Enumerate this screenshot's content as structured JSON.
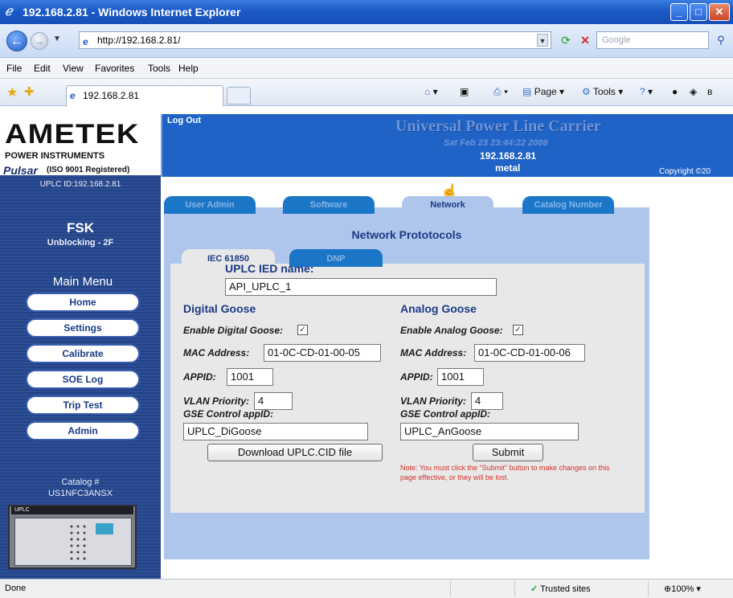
{
  "window": {
    "title": "192.168.2.81 - Windows Internet Explorer",
    "minimize": "_",
    "maximize": "□",
    "close": "✕"
  },
  "address": {
    "url": "http://192.168.2.81/",
    "search_placeholder": "Google"
  },
  "menu": [
    "File",
    "Edit",
    "View",
    "Favorites",
    "Tools",
    "Help"
  ],
  "tabs": {
    "active_label": "192.168.2.81"
  },
  "commands": {
    "home": "▾",
    "page": "Page ▾",
    "tools": "Tools ▾",
    "help": "▾"
  },
  "branding": {
    "company": "AMETEK",
    "division": "POWER INSTRUMENTS",
    "product_line": "Pulsar",
    "iso": "(ISO 9001 Registered)"
  },
  "header": {
    "logout": "Log Out",
    "product_title": "Universal Power Line Carrier",
    "date": "Sat Feb 23 23:44:22 2008",
    "ip": "192.168.2.81",
    "user": "metal",
    "copyright": "Copyright ©20"
  },
  "sidebar": {
    "upl_id": "UPLC ID:192.168.2.81",
    "mode": "FSK",
    "scheme": "Unblocking - 2F",
    "menu_title": "Main Menu",
    "items": [
      {
        "label": "Home"
      },
      {
        "label": "Settings"
      },
      {
        "label": "Calibrate"
      },
      {
        "label": "SOE Log"
      },
      {
        "label": "Trip Test"
      },
      {
        "label": "Admin"
      }
    ],
    "catalog_label": "Catalog #",
    "catalog_number": "US1NFC3ANSX",
    "device_label": "UPLC"
  },
  "main_tabs": [
    {
      "label": "User Admin"
    },
    {
      "label": "Software"
    },
    {
      "label": "Network"
    },
    {
      "label": "Catalog Number"
    }
  ],
  "network": {
    "title": "Network Prototocols",
    "sub_tabs": [
      {
        "label": "IEC 61850"
      },
      {
        "label": "DNP"
      }
    ],
    "ied_label": "UPLC IED name:",
    "ied_value": "API_UPLC_1",
    "digital": {
      "heading": "Digital Goose",
      "enable_label": "Enable Digital Goose:",
      "enabled": "✓",
      "mac_label": "MAC Address:",
      "mac_value": "01-0C-CD-01-00-05",
      "appid_label": "APPID:",
      "appid_value": "1001",
      "vlan_label": "VLAN Priority:",
      "vlan_value": "4",
      "gse_label": "GSE Control appID:",
      "gse_value": "UPLC_DiGoose"
    },
    "analog": {
      "heading": "Analog Goose",
      "enable_label": "Enable Analog Goose:",
      "enabled": "✓",
      "mac_label": "MAC Address:",
      "mac_value": "01-0C-CD-01-00-06",
      "appid_label": "APPID:",
      "appid_value": "1001",
      "vlan_label": "VLAN Priority:",
      "vlan_value": "4",
      "gse_label": "GSE Control appID:",
      "gse_value": "UPLC_AnGoose"
    },
    "download_button": "Download UPLC.CID file",
    "submit_button": "Submit",
    "note": "Note: You must click the \"Submit\" button to make changes on this page effective, or they will be lost."
  },
  "status": {
    "text": "Done",
    "zone": "Trusted sites",
    "zoom": "100%"
  },
  "colors": {
    "header_blue": "#1f63c6",
    "sidebar_blue": "#24468e",
    "content_bg": "#aec6eb",
    "label_blue": "#1b3a86",
    "note_red": "#d5302a"
  }
}
